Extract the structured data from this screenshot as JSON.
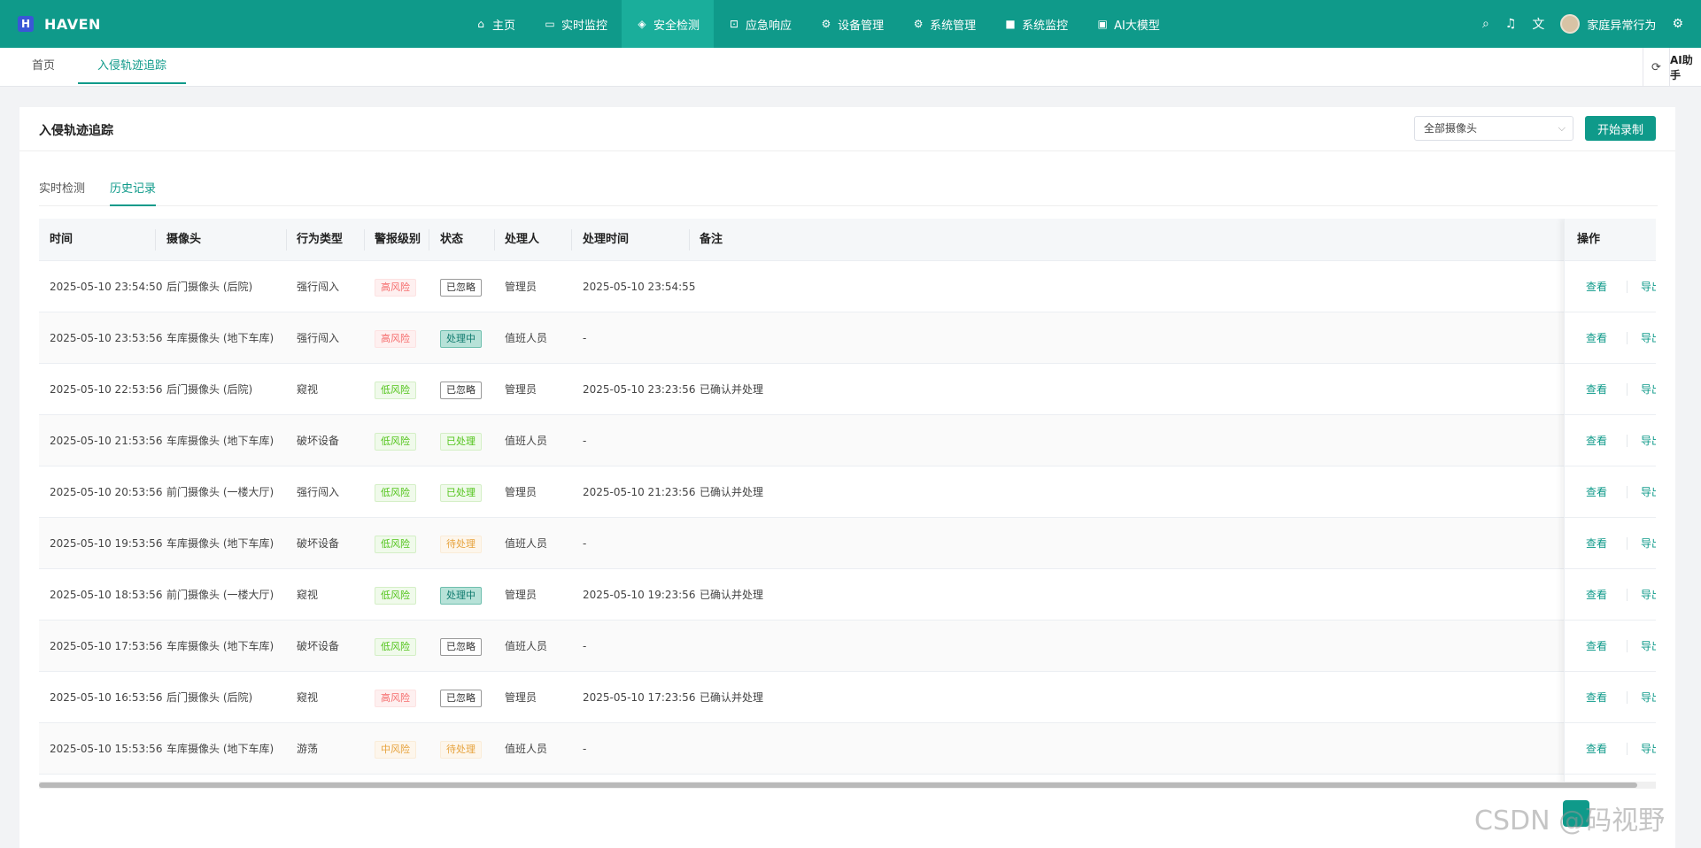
{
  "app": {
    "logo_letter": "H",
    "name": "HAVEN"
  },
  "nav": [
    {
      "icon": "home-icon",
      "glyph": "⌂",
      "label": "主页"
    },
    {
      "icon": "video-icon",
      "glyph": "▭",
      "label": "实时监控"
    },
    {
      "icon": "shield-check-icon",
      "glyph": "◈",
      "label": "安全检测",
      "active": true
    },
    {
      "icon": "lock-icon",
      "glyph": "⊡",
      "label": "应急响应"
    },
    {
      "icon": "gear-icon",
      "glyph": "⚙",
      "label": "设备管理"
    },
    {
      "icon": "gear-icon",
      "glyph": "⚙",
      "label": "系统管理"
    },
    {
      "icon": "camera-icon",
      "glyph": "■",
      "label": "系统监控"
    },
    {
      "icon": "ai-icon",
      "glyph": "▣",
      "label": "AI大模型"
    }
  ],
  "topbar": {
    "user_name": "家庭异常行为"
  },
  "tabs": {
    "home": "首页",
    "current": "入侵轨迹追踪",
    "ai_assistant": "AI助手"
  },
  "page": {
    "title": "入侵轨迹追踪",
    "camera_select": "全部摄像头",
    "record_button": "开始录制",
    "subtabs": [
      "实时检测",
      "历史记录"
    ]
  },
  "table": {
    "headers": {
      "time": "时间",
      "camera": "摄像头",
      "behavior": "行为类型",
      "level": "警报级别",
      "status": "状态",
      "handler": "处理人",
      "handled_time": "处理时间",
      "note": "备注",
      "ops": "操作"
    },
    "rows": [
      {
        "time": "2025-05-10 23:54:50",
        "camera": "后门摄像头 (后院)",
        "behavior": "强行闯入",
        "level": "高风险",
        "level_class": "lvl-high",
        "status": "已忽略",
        "status_class": "st-ignore",
        "handler": "管理员",
        "handled_time": "2025-05-10 23:54:55",
        "note": ""
      },
      {
        "time": "2025-05-10 23:53:56",
        "camera": "车库摄像头 (地下车库)",
        "behavior": "强行闯入",
        "level": "高风险",
        "level_class": "lvl-high",
        "status": "处理中",
        "status_class": "st-proc",
        "handler": "值班人员",
        "handled_time": "-",
        "note": ""
      },
      {
        "time": "2025-05-10 22:53:56",
        "camera": "后门摄像头 (后院)",
        "behavior": "窥视",
        "level": "低风险",
        "level_class": "lvl-low",
        "status": "已忽略",
        "status_class": "st-ignore",
        "handler": "管理员",
        "handled_time": "2025-05-10 23:23:56",
        "note": "已确认并处理"
      },
      {
        "time": "2025-05-10 21:53:56",
        "camera": "车库摄像头 (地下车库)",
        "behavior": "破坏设备",
        "level": "低风险",
        "level_class": "lvl-low",
        "status": "已处理",
        "status_class": "st-done",
        "handler": "值班人员",
        "handled_time": "-",
        "note": ""
      },
      {
        "time": "2025-05-10 20:53:56",
        "camera": "前门摄像头 (一楼大厅)",
        "behavior": "强行闯入",
        "level": "低风险",
        "level_class": "lvl-low",
        "status": "已处理",
        "status_class": "st-done",
        "handler": "管理员",
        "handled_time": "2025-05-10 21:23:56",
        "note": "已确认并处理"
      },
      {
        "time": "2025-05-10 19:53:56",
        "camera": "车库摄像头 (地下车库)",
        "behavior": "破坏设备",
        "level": "低风险",
        "level_class": "lvl-low",
        "status": "待处理",
        "status_class": "st-pend",
        "handler": "值班人员",
        "handled_time": "-",
        "note": ""
      },
      {
        "time": "2025-05-10 18:53:56",
        "camera": "前门摄像头 (一楼大厅)",
        "behavior": "窥视",
        "level": "低风险",
        "level_class": "lvl-low",
        "status": "处理中",
        "status_class": "st-proc",
        "handler": "管理员",
        "handled_time": "2025-05-10 19:23:56",
        "note": "已确认并处理"
      },
      {
        "time": "2025-05-10 17:53:56",
        "camera": "车库摄像头 (地下车库)",
        "behavior": "破坏设备",
        "level": "低风险",
        "level_class": "lvl-low",
        "status": "已忽略",
        "status_class": "st-ignore",
        "handler": "值班人员",
        "handled_time": "-",
        "note": ""
      },
      {
        "time": "2025-05-10 16:53:56",
        "camera": "后门摄像头 (后院)",
        "behavior": "窥视",
        "level": "高风险",
        "level_class": "lvl-high",
        "status": "已忽略",
        "status_class": "st-ignore",
        "handler": "管理员",
        "handled_time": "2025-05-10 17:23:56",
        "note": "已确认并处理"
      },
      {
        "time": "2025-05-10 15:53:56",
        "camera": "车库摄像头 (地下车库)",
        "behavior": "游荡",
        "level": "中风险",
        "level_class": "lvl-mid",
        "status": "待处理",
        "status_class": "st-pend",
        "handler": "值班人员",
        "handled_time": "-",
        "note": ""
      }
    ],
    "op_view": "查看",
    "op_export": "导出"
  },
  "watermark": "CSDN @码视野",
  "colors": {
    "primary": "#0f9a8a",
    "nav_active": "#1aae9b"
  }
}
